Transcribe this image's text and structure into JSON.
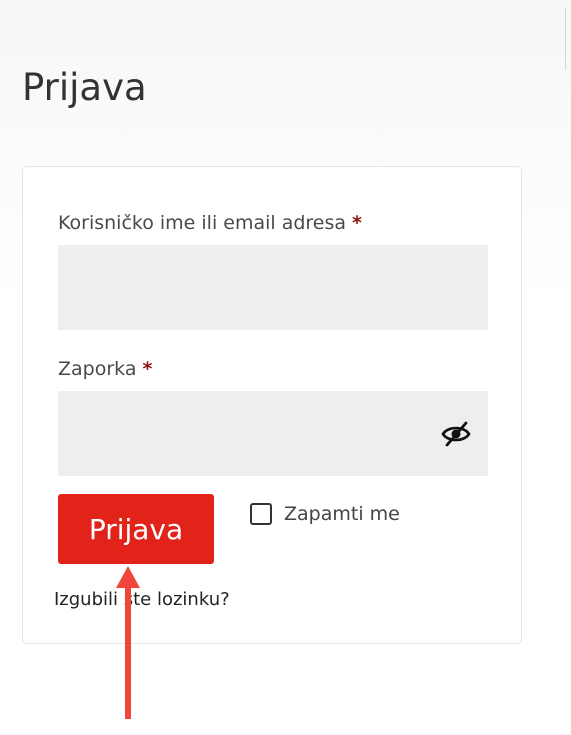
{
  "page": {
    "title": "Prijava"
  },
  "form": {
    "username_label": "Korisničko ime ili email adresa",
    "username_required": "*",
    "username_value": "",
    "password_label": "Zaporka",
    "password_required": "*",
    "password_value": "",
    "password_toggle_icon": "eye-slash-icon",
    "submit_label": "Prijava",
    "remember_label": "Zapamti me",
    "remember_checked": false,
    "lost_password_link": "Izgubili ste lozinku?"
  },
  "colors": {
    "accent": "#e2231a",
    "required": "#8f1111",
    "input_bg": "#eeeeee",
    "annotation_arrow": "#f0453a"
  },
  "annotation": {
    "arrow": "points-up-to-submit-button"
  }
}
